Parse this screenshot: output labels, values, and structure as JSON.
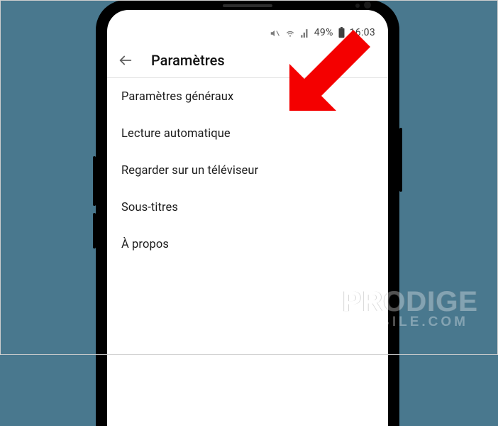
{
  "statusbar": {
    "battery_text": "49%",
    "time": "16:03"
  },
  "appbar": {
    "title": "Paramètres"
  },
  "settings": {
    "items": [
      {
        "label": "Paramètres généraux"
      },
      {
        "label": "Lecture automatique"
      },
      {
        "label": "Regarder sur un téléviseur"
      },
      {
        "label": "Sous-titres"
      },
      {
        "label": "À propos"
      }
    ]
  },
  "watermark": {
    "line1": "PRODIGE",
    "line2": "MOBILE.COM"
  }
}
